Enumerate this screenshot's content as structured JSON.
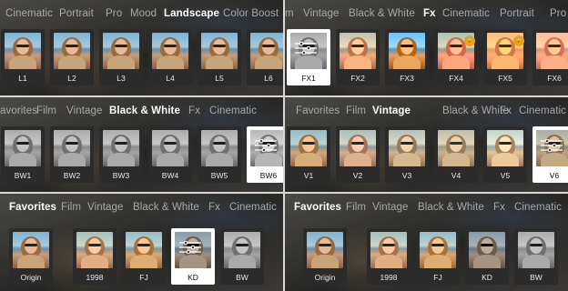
{
  "panels": [
    {
      "tabs": [
        {
          "label": "Cinematic",
          "active": false
        },
        {
          "label": "Portrait",
          "active": false
        },
        {
          "label": "Pro",
          "active": false
        },
        {
          "label": "Mood",
          "active": false
        },
        {
          "label": "Landscape",
          "active": true
        },
        {
          "label": "Color Boost",
          "active": false
        }
      ],
      "filters": [
        {
          "label": "L1",
          "style": "",
          "selected": false,
          "locked": false
        },
        {
          "label": "L2",
          "style": "",
          "selected": false,
          "locked": false
        },
        {
          "label": "L3",
          "style": "",
          "selected": false,
          "locked": false
        },
        {
          "label": "L4",
          "style": "",
          "selected": false,
          "locked": false
        },
        {
          "label": "L5",
          "style": "",
          "selected": false,
          "locked": false
        },
        {
          "label": "L6",
          "style": "",
          "selected": false,
          "locked": false
        }
      ]
    },
    {
      "tabs": [
        {
          "label": "m",
          "active": false
        },
        {
          "label": "Vintage",
          "active": false
        },
        {
          "label": "Black & White",
          "active": false
        },
        {
          "label": "Fx",
          "active": true
        },
        {
          "label": "Cinematic",
          "active": false
        },
        {
          "label": "Portrait",
          "active": false
        },
        {
          "label": "Pro",
          "active": false
        }
      ],
      "filters": [
        {
          "label": "FX1",
          "style": "bw",
          "selected": true,
          "locked": false
        },
        {
          "label": "FX2",
          "style": "fx2",
          "selected": false,
          "locked": false
        },
        {
          "label": "FX3",
          "style": "fx3",
          "selected": false,
          "locked": false
        },
        {
          "label": "FX4",
          "style": "fx4",
          "selected": false,
          "locked": true
        },
        {
          "label": "FX5",
          "style": "fx5",
          "selected": false,
          "locked": true
        },
        {
          "label": "FX6",
          "style": "fx6",
          "selected": false,
          "locked": false
        }
      ]
    },
    {
      "tabs": [
        {
          "label": "avorites",
          "active": false
        },
        {
          "label": "Film",
          "active": false
        },
        {
          "label": "Vintage",
          "active": false
        },
        {
          "label": "Black & White",
          "active": true
        },
        {
          "label": "Fx",
          "active": false
        },
        {
          "label": "Cinematic",
          "active": false
        }
      ],
      "filters": [
        {
          "label": "BW1",
          "style": "bw",
          "selected": false,
          "locked": false
        },
        {
          "label": "BW2",
          "style": "bw",
          "selected": false,
          "locked": false
        },
        {
          "label": "BW3",
          "style": "bw",
          "selected": false,
          "locked": false
        },
        {
          "label": "BW4",
          "style": "bw",
          "selected": false,
          "locked": false
        },
        {
          "label": "BW5",
          "style": "bw",
          "selected": false,
          "locked": false
        },
        {
          "label": "BW6",
          "style": "bwkd",
          "selected": true,
          "locked": false
        }
      ]
    },
    {
      "tabs": [
        {
          "label": "Favorites",
          "active": false
        },
        {
          "label": "Film",
          "active": false
        },
        {
          "label": "Vintage",
          "active": true
        },
        {
          "label": "Black & White",
          "active": false
        },
        {
          "label": "Fx",
          "active": false
        },
        {
          "label": "Cinematic",
          "active": false
        }
      ],
      "filters": [
        {
          "label": "V1",
          "style": "v1",
          "selected": false,
          "locked": false
        },
        {
          "label": "V2",
          "style": "v2",
          "selected": false,
          "locked": false
        },
        {
          "label": "V3",
          "style": "v3",
          "selected": false,
          "locked": false
        },
        {
          "label": "V4",
          "style": "v4",
          "selected": false,
          "locked": false
        },
        {
          "label": "V5",
          "style": "v5",
          "selected": false,
          "locked": false
        },
        {
          "label": "V6",
          "style": "v6",
          "selected": true,
          "locked": false
        }
      ]
    },
    {
      "tabs": [
        {
          "label": "Favorites",
          "active": true
        },
        {
          "label": "Film",
          "active": false
        },
        {
          "label": "Vintage",
          "active": false
        },
        {
          "label": "Black & White",
          "active": false
        },
        {
          "label": "Fx",
          "active": false
        },
        {
          "label": "Cinematic",
          "active": false
        }
      ],
      "filters": [
        {
          "label": "Origin",
          "style": "",
          "selected": false,
          "locked": false
        },
        {
          "label": "1998",
          "style": "1998",
          "selected": false,
          "locked": false
        },
        {
          "label": "FJ",
          "style": "fj",
          "selected": false,
          "locked": false
        },
        {
          "label": "KD",
          "style": "kd",
          "selected": true,
          "locked": false
        },
        {
          "label": "BW",
          "style": "bw",
          "selected": false,
          "locked": false
        }
      ]
    },
    {
      "tabs": [
        {
          "label": "Favorites",
          "active": true
        },
        {
          "label": "Film",
          "active": false
        },
        {
          "label": "Vintage",
          "active": false
        },
        {
          "label": "Black & White",
          "active": false
        },
        {
          "label": "Fx",
          "active": false
        },
        {
          "label": "Cinematic",
          "active": false
        }
      ],
      "filters": [
        {
          "label": "Origin",
          "style": "",
          "selected": false,
          "locked": false
        },
        {
          "label": "1998",
          "style": "1998",
          "selected": false,
          "locked": false
        },
        {
          "label": "FJ",
          "style": "fj",
          "selected": false,
          "locked": false
        },
        {
          "label": "KD",
          "style": "kd",
          "selected": false,
          "locked": false
        },
        {
          "label": "BW",
          "style": "bw",
          "selected": false,
          "locked": false
        }
      ]
    }
  ],
  "colors": {
    "active_tab": "#ffffff",
    "inactive_tab": "#a9a9a9",
    "lock_badge": "#e8a21c",
    "card": "#2b2b2b"
  },
  "icons": {
    "selected_overlay": "adjust-sliders-icon",
    "locked_badge": "lock-icon"
  }
}
